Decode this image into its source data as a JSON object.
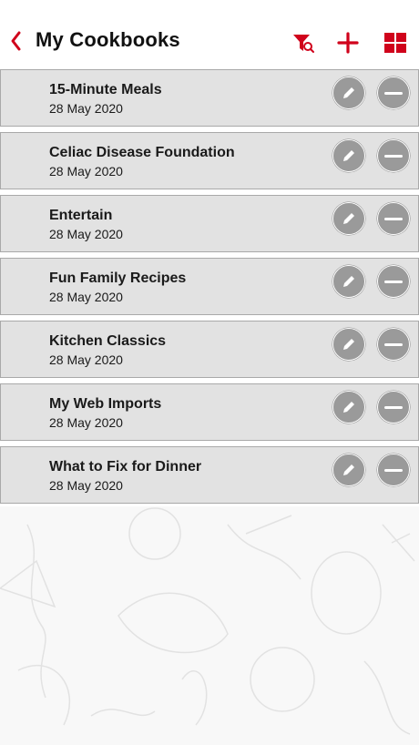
{
  "header": {
    "title": "My Cookbooks",
    "colors": {
      "accent": "#d0021b"
    },
    "icons": {
      "back": "chevron-left-icon",
      "filter": "filter-search-icon",
      "add": "plus-icon",
      "grid": "grid-view-icon"
    }
  },
  "cookbooks": [
    {
      "title": "15-Minute Meals",
      "date": "28 May 2020"
    },
    {
      "title": "Celiac Disease Foundation",
      "date": "28 May 2020"
    },
    {
      "title": "Entertain",
      "date": "28 May 2020"
    },
    {
      "title": "Fun Family Recipes",
      "date": "28 May 2020"
    },
    {
      "title": "Kitchen Classics",
      "date": "28 May 2020"
    },
    {
      "title": "My Web Imports",
      "date": "28 May 2020"
    },
    {
      "title": "What to Fix for Dinner",
      "date": "28 May 2020"
    }
  ],
  "row_icons": {
    "edit": "pencil-icon",
    "remove": "minus-icon"
  }
}
